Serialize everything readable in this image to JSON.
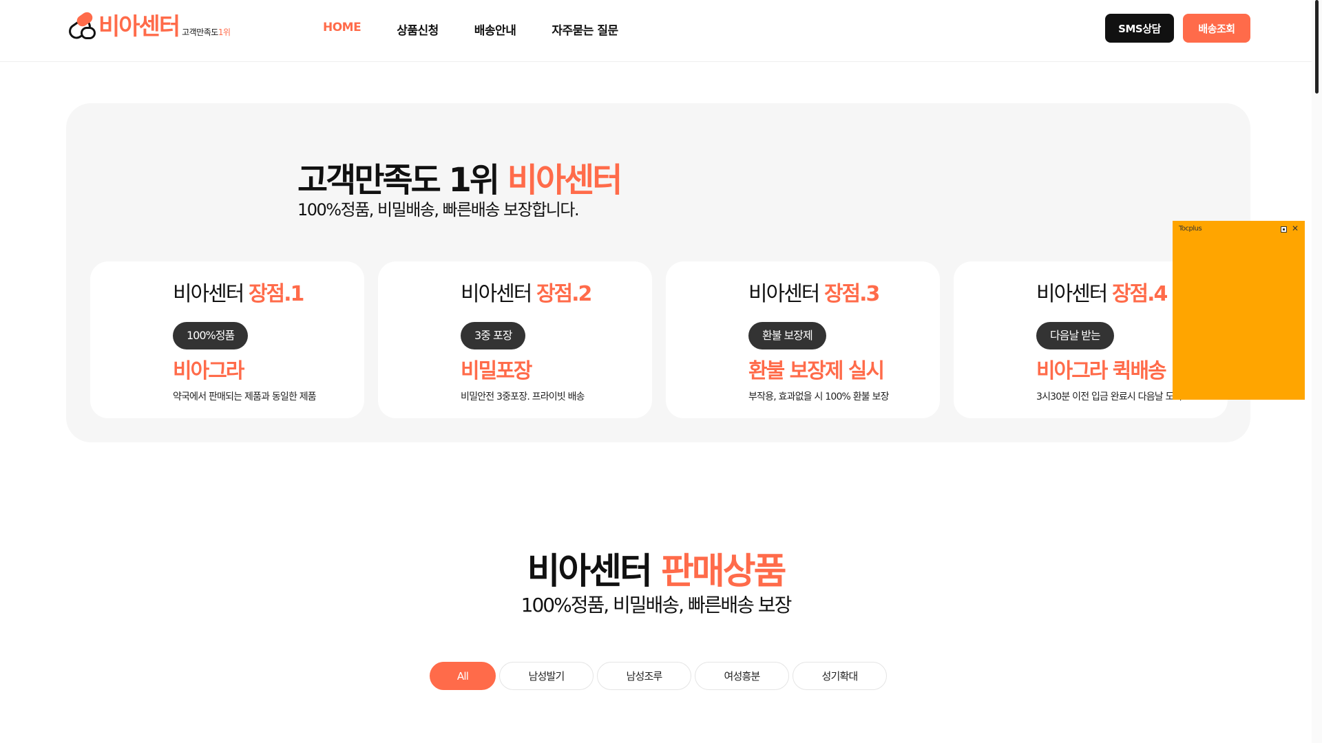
{
  "header": {
    "logo": {
      "text": "비아센터",
      "sub_prefix": "고객만족도",
      "sub_accent": "1위"
    },
    "nav": [
      {
        "label": "HOME",
        "active": true
      },
      {
        "label": "상품신청"
      },
      {
        "label": "배송안내"
      },
      {
        "label": "자주묻는 질문"
      }
    ],
    "sms_button": "SMS상담",
    "delivery_button": "배송조회"
  },
  "hero": {
    "title_prefix": "고객만족도 1위 ",
    "title_accent": "비아센터",
    "subtitle": "100%정품, 비밀배송, 빠른배송 보장합니다.",
    "cards": [
      {
        "title_prefix": "비아센터 ",
        "title_accent": "장점.1",
        "badge": "100%정품",
        "headline": "비아그라",
        "desc": "약국에서 판매되는 제품과 동일한 제품"
      },
      {
        "title_prefix": "비아센터 ",
        "title_accent": "장점.2",
        "badge": "3중 포장",
        "headline": "비밀포장",
        "desc": "비밀안전 3중포장. 프라이빗 배송"
      },
      {
        "title_prefix": "비아센터 ",
        "title_accent": "장점.3",
        "badge": "환불 보장제",
        "headline": "환불 보장제 실시",
        "desc": "부작용, 효과없을 시 100% 환불 보장"
      },
      {
        "title_prefix": "비아센터 ",
        "title_accent": "장점.4",
        "badge": "다음날 받는",
        "headline": "비아그라 퀵배송",
        "desc": "3시30분 이전 입금 완료시 다음날 도착"
      }
    ]
  },
  "products": {
    "title_prefix": "비아센터 ",
    "title_accent": "판매상품",
    "subtitle": "100%정품, 비밀배송, 빠른배송 보장",
    "filters": [
      {
        "label": "All",
        "active": true
      },
      {
        "label": "남성발기"
      },
      {
        "label": "남성조루"
      },
      {
        "label": "여성흥분"
      },
      {
        "label": "성기확대"
      }
    ]
  },
  "ad": {
    "label": "Tocplus"
  },
  "colors": {
    "accent": "#ff6b4a",
    "dark": "#111111",
    "badge": "#333333",
    "panel": "#f6f6f6",
    "ad": "#ffa500"
  }
}
